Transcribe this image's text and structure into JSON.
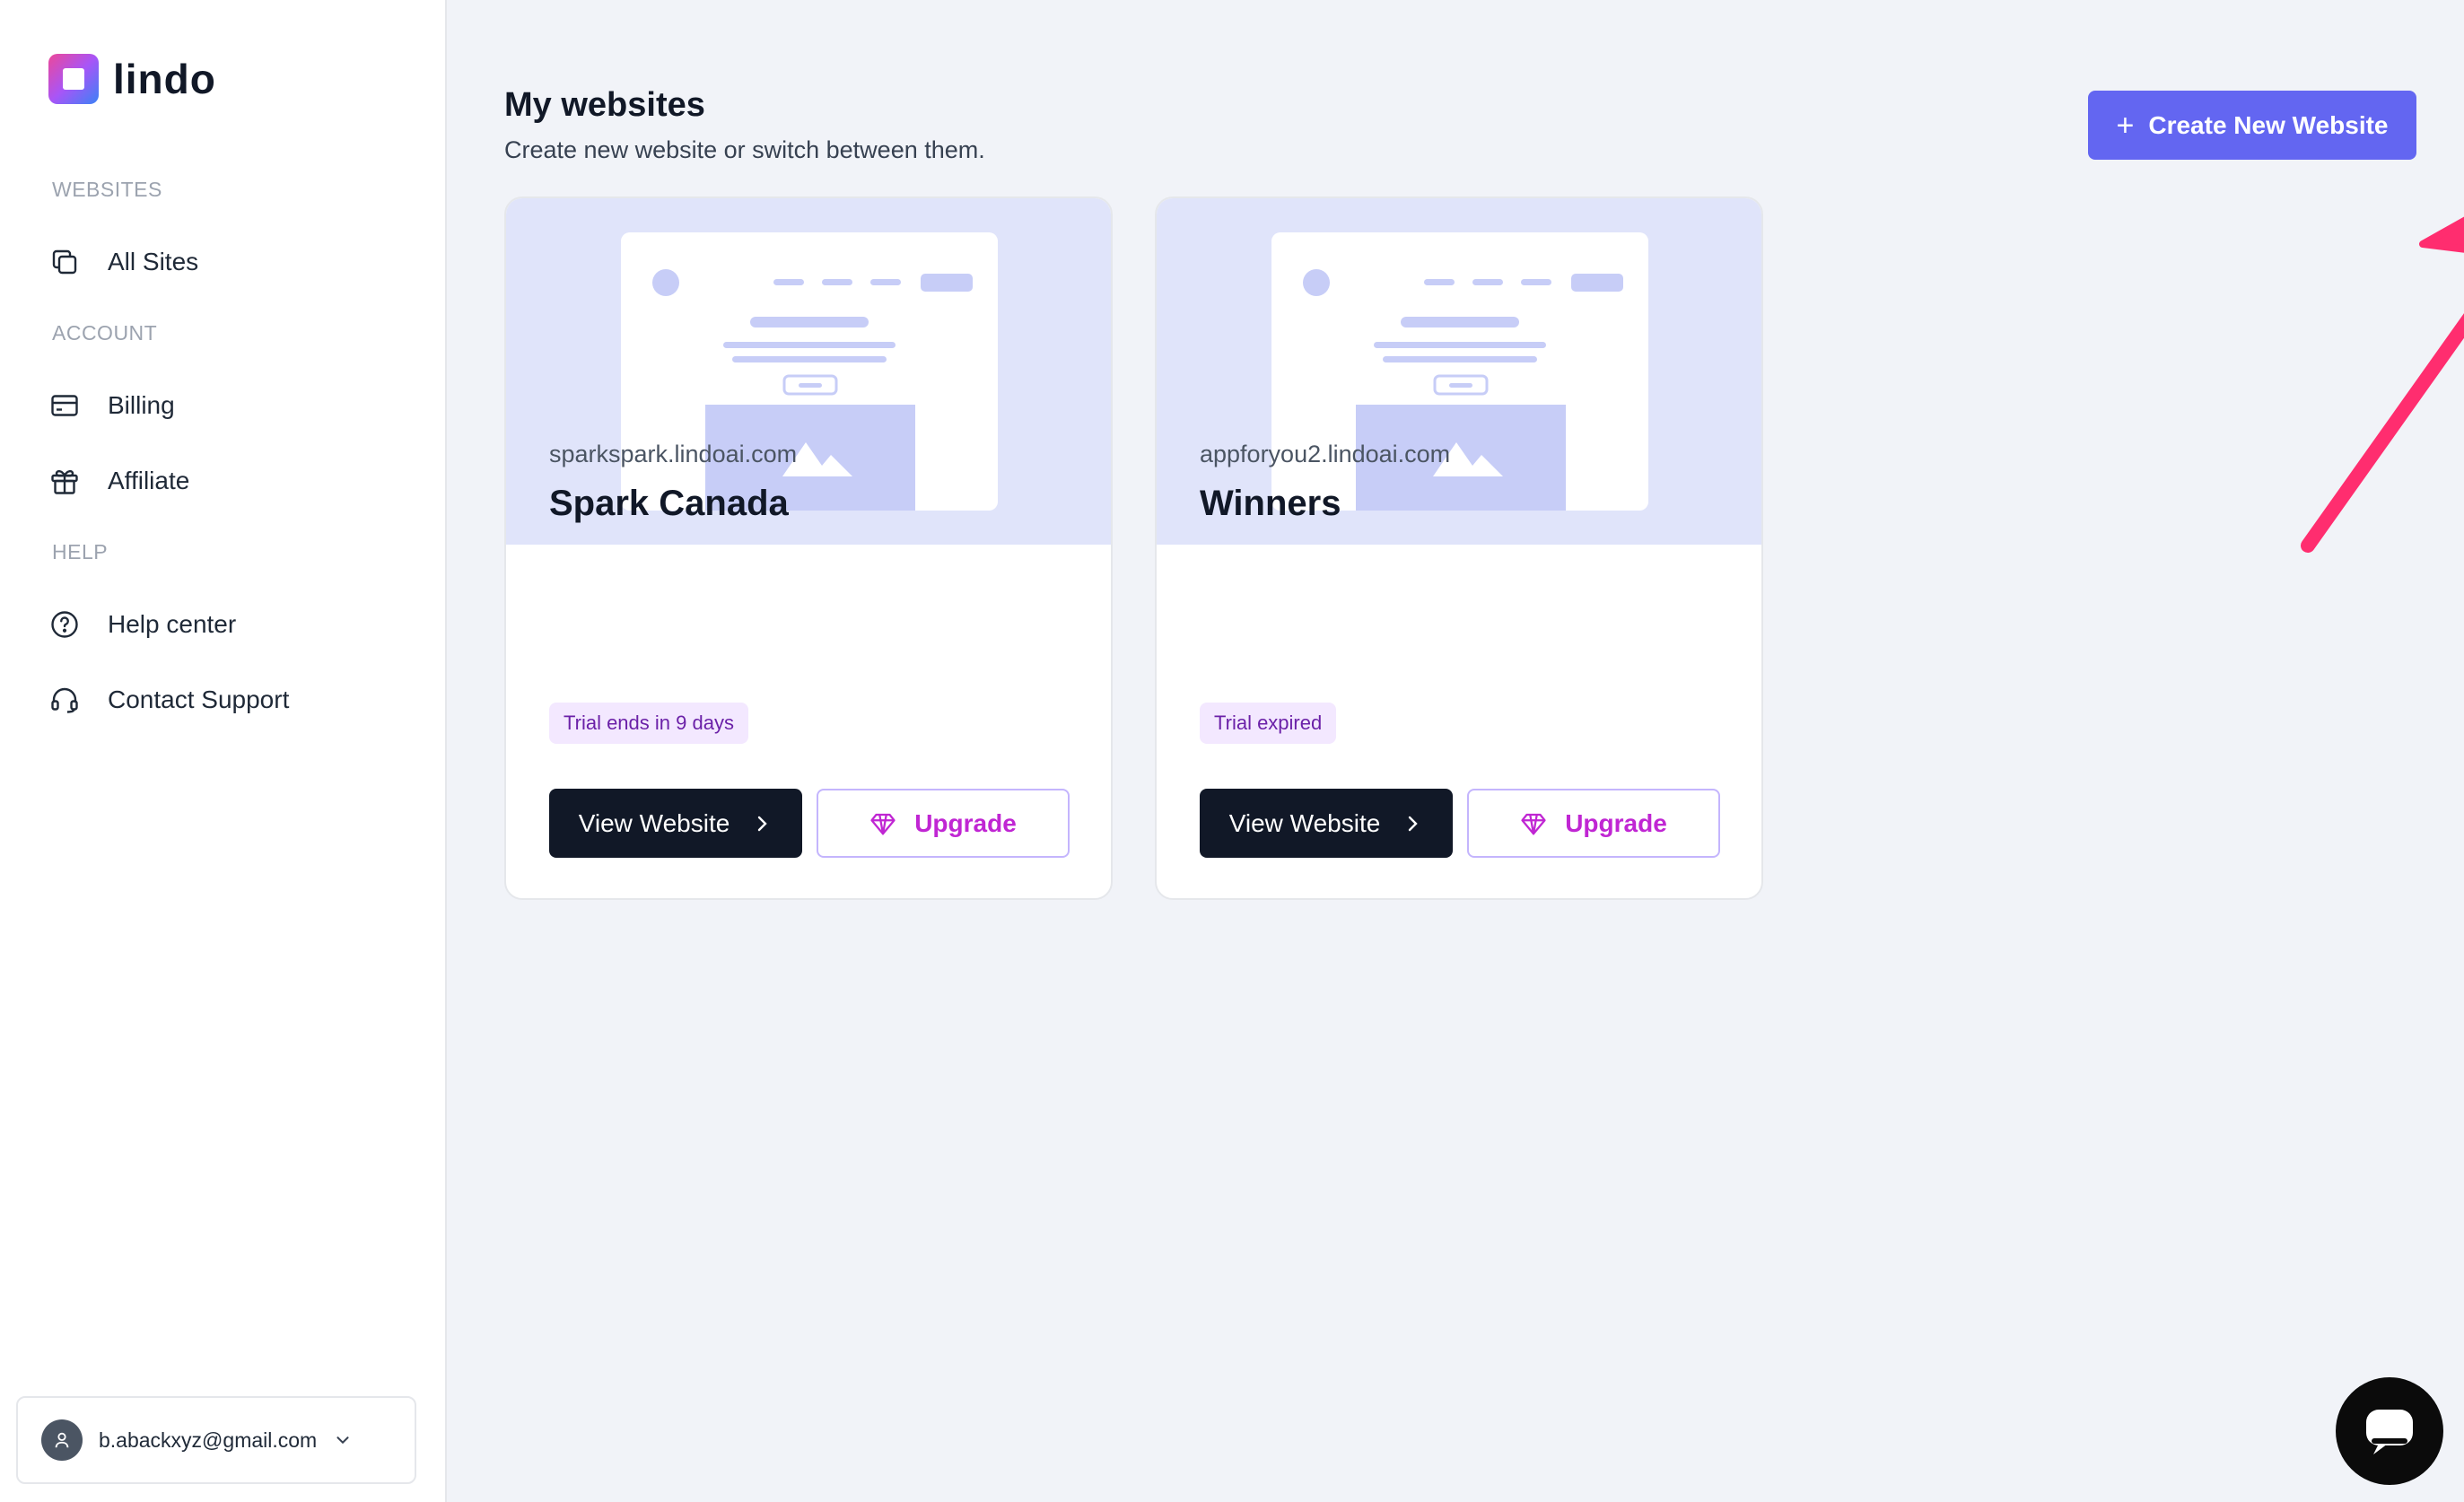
{
  "brand": {
    "name": "lindo"
  },
  "sidebar": {
    "sections": {
      "websites": "WEBSITES",
      "account": "ACCOUNT",
      "help": "HELP"
    },
    "items": {
      "all_sites": "All Sites",
      "billing": "Billing",
      "affiliate": "Affiliate",
      "help_center": "Help center",
      "contact_support": "Contact Support"
    },
    "user": {
      "email": "b.abackxyz@gmail.com"
    }
  },
  "main": {
    "title": "My websites",
    "subtitle": "Create new website or switch between them.",
    "create_button": "Create New Website",
    "create_button_icon": "+"
  },
  "sites": [
    {
      "domain": "sparkspark.lindoai.com",
      "name": "Spark Canada",
      "status": "Trial ends in 9 days",
      "view_label": "View Website",
      "upgrade_label": "Upgrade"
    },
    {
      "domain": "appforyou2.lindoai.com",
      "name": "Winners",
      "status": "Trial expired",
      "view_label": "View Website",
      "upgrade_label": "Upgrade"
    }
  ],
  "colors": {
    "primary": "#6366f1",
    "dark_button": "#111827",
    "upgrade_text": "#c026d3",
    "badge_bg": "#f3e8ff",
    "badge_text": "#6b21a8",
    "preview_bg": "#e0e4fa",
    "annotation_arrow": "#ff2d6f"
  }
}
